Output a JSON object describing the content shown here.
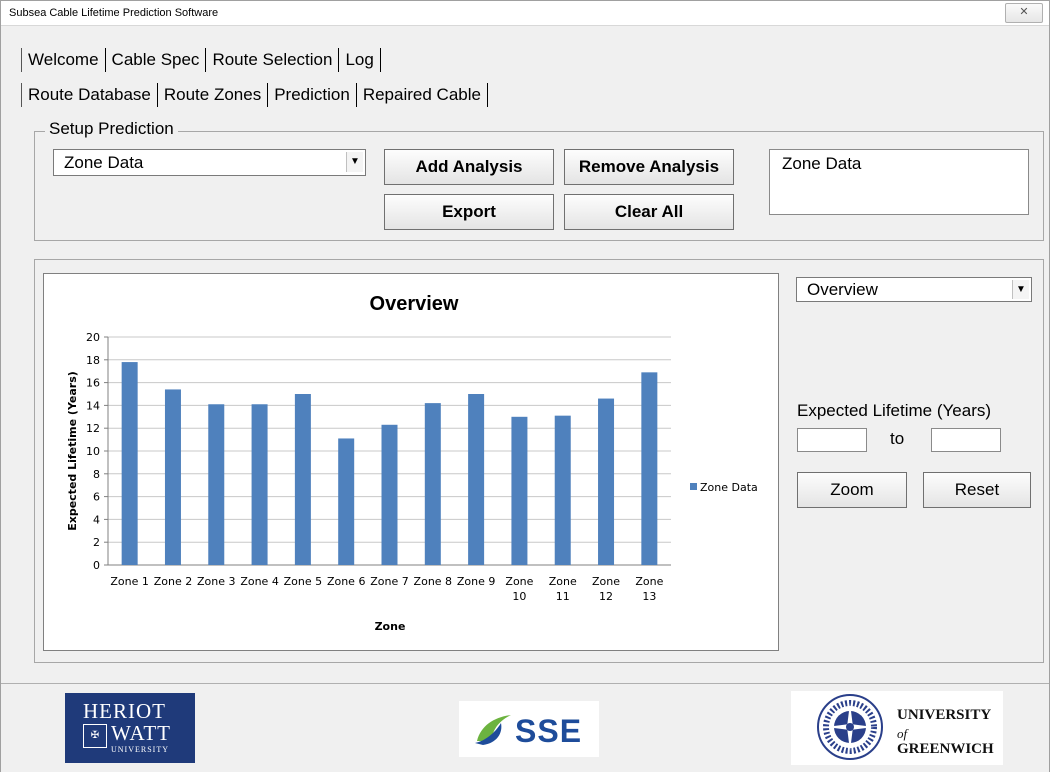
{
  "window": {
    "title": "Subsea Cable Lifetime Prediction Software",
    "close_label": "✕"
  },
  "tabs_main": [
    {
      "label": "Welcome",
      "active": false
    },
    {
      "label": "Cable Spec",
      "active": false
    },
    {
      "label": "Route Selection",
      "active": true
    },
    {
      "label": "Log",
      "active": false
    }
  ],
  "tabs_sub": [
    {
      "label": "Route Database",
      "active": false
    },
    {
      "label": "Route Zones",
      "active": false
    },
    {
      "label": "Prediction",
      "active": true
    },
    {
      "label": "Repaired Cable",
      "active": false
    }
  ],
  "setup": {
    "group_label": "Setup Prediction",
    "data_select": "Zone Data",
    "add_label": "Add Analysis",
    "remove_label": "Remove Analysis",
    "export_label": "Export",
    "clear_label": "Clear All",
    "analysis_list": [
      "Zone Data"
    ]
  },
  "view": {
    "view_select": "Overview",
    "range_label": "Expected Lifetime (Years)",
    "from_value": "",
    "to_label": "to",
    "to_value": "",
    "zoom_label": "Zoom",
    "reset_label": "Reset"
  },
  "chart_data": {
    "type": "bar",
    "title": "Overview",
    "xlabel": "Zone",
    "ylabel": "Expected Lifetime (Years)",
    "categories": [
      "Zone 1",
      "Zone 2",
      "Zone 3",
      "Zone 4",
      "Zone 5",
      "Zone 6",
      "Zone 7",
      "Zone 8",
      "Zone 9",
      "Zone 10",
      "Zone 11",
      "Zone 12",
      "Zone 13"
    ],
    "series": [
      {
        "name": "Zone Data",
        "color": "#4f81bd",
        "values": [
          17.8,
          15.4,
          14.1,
          14.1,
          15.0,
          11.1,
          12.3,
          14.2,
          15.0,
          13.0,
          13.1,
          14.6,
          16.9
        ]
      }
    ],
    "ylim": [
      0,
      20
    ],
    "yticks": [
      "0",
      "2",
      "4",
      "6",
      "8",
      "10",
      "12",
      "14",
      "16",
      "18",
      "20"
    ],
    "grid": true,
    "legend": "right"
  },
  "footer": {
    "hw": {
      "line1": "HERIOT",
      "line2": "WATT",
      "line3": "UNIVERSITY"
    },
    "sse": {
      "text": "SSE"
    },
    "ug": {
      "line1": "UNIVERSITY",
      "line2": "of",
      "line3": "GREENWICH"
    }
  }
}
